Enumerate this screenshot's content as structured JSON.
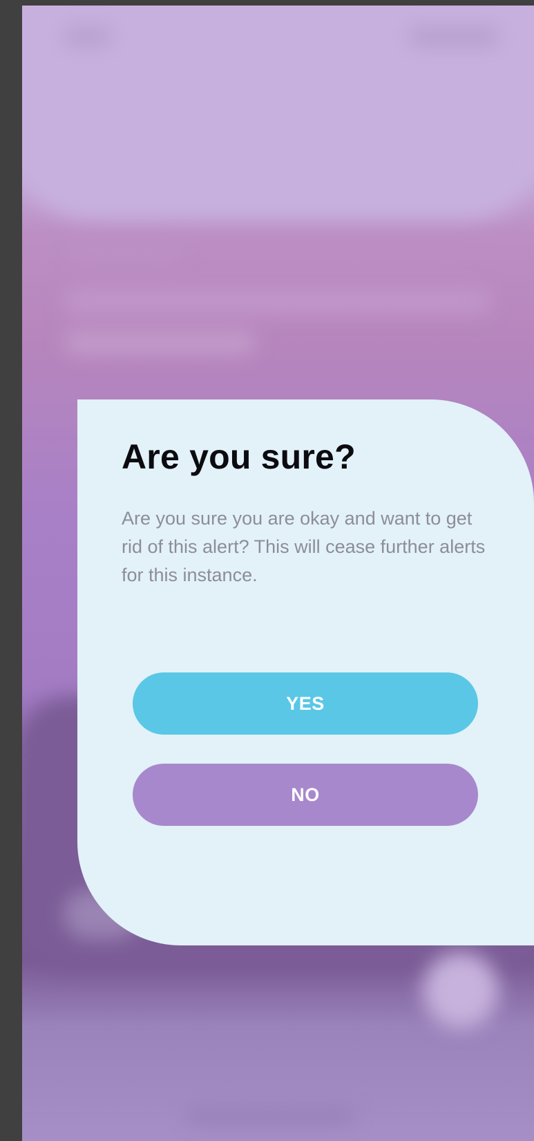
{
  "dialog": {
    "title": "Are you sure?",
    "message": "Are you sure you are okay and want to get rid of this alert? This will cease further alerts for this instance.",
    "yes_label": "YES",
    "no_label": "NO"
  },
  "colors": {
    "dialog_background": "#e2f2f8",
    "yes_button": "#5bc7e6",
    "no_button": "#a888cc",
    "title_text": "#0b0b10",
    "body_text": "#8d8d97"
  }
}
